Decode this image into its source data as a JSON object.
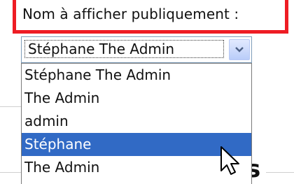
{
  "field": {
    "label": "Nom à afficher publiquement :",
    "selected_value": "Stéphane The Admin"
  },
  "dropdown": {
    "options": [
      "Stéphane The Admin",
      "The Admin",
      "admin",
      "Stéphane",
      "The Admin"
    ],
    "highlighted_option": "Stéphane"
  },
  "background": {
    "partial_text": "s"
  },
  "colors": {
    "highlight_box": "#ee1c24",
    "selection": "#316ac5"
  }
}
